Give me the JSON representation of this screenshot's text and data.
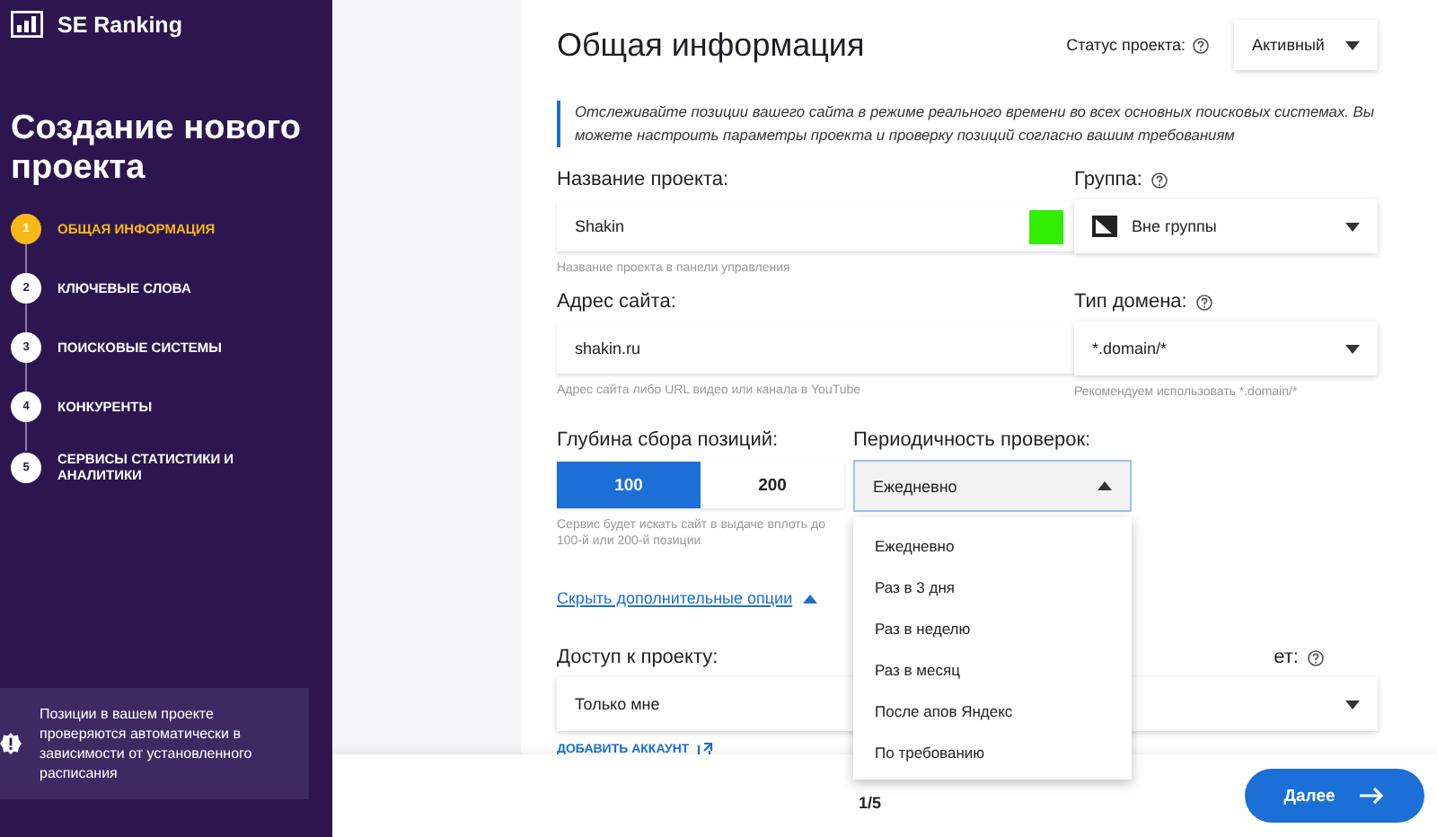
{
  "sidebar": {
    "logo": "SE Ranking",
    "title": "Создание нового проекта",
    "steps": [
      {
        "number": "1",
        "label": "ОБЩАЯ ИНФОРМАЦИЯ",
        "selected": true
      },
      {
        "number": "2",
        "label": "КЛЮЧЕВЫЕ СЛОВА",
        "selected": false
      },
      {
        "number": "3",
        "label": "ПОИСКОВЫЕ СИСТЕМЫ",
        "selected": false
      },
      {
        "number": "4",
        "label": "КОНКУРЕНТЫ",
        "selected": false
      },
      {
        "number": "5",
        "label": "СЕРВИСЫ СТАТИСТИКИ И АНАЛИТИКИ",
        "selected": false
      }
    ],
    "notice": "Позиции в вашем проекте проверяются автоматически в зависимости от установленного расписания"
  },
  "main": {
    "title": "Общая информация",
    "status": {
      "label": "Статус проекта:",
      "value": "Активный"
    },
    "description": "Отслеживайте позиции вашего сайта в режиме реального времени во всех основных поисковых системах. Вы можете настроить параметры проекта и проверку позиций согласно вашим требованиям",
    "project_name": {
      "label": "Название проекта:",
      "value": "Shakin",
      "color": "#33ee00",
      "hint": "Название проекта в панели управления"
    },
    "group": {
      "label": "Группа:",
      "value": "Вне группы"
    },
    "site_address": {
      "label": "Адрес сайта:",
      "value": "shakin.ru",
      "hint": "Адрес сайта либо URL видео или канала в YouTube"
    },
    "domain_type": {
      "label": "Тип домена:",
      "value": "*.domain/*",
      "hint": "Рекомендуем использовать *.domain/*"
    },
    "depth": {
      "label": "Глубина сбора позиций:",
      "options": [
        {
          "label": "100",
          "selected": true
        },
        {
          "label": "200",
          "selected": false
        }
      ],
      "hint": "Сервис будет искать сайт в выдаче вплоть до 100-й или 200-й позиции"
    },
    "frequency": {
      "label": "Периодичность проверок:",
      "value": "Ежедневно",
      "expanded": true,
      "options": [
        "Ежедневно",
        "Раз в 3 дня",
        "Раз в неделю",
        "Раз в месяц",
        "После апов Яндекс",
        "По требованию"
      ]
    },
    "toggle_link": "Скрыть дополнительные опции",
    "access": {
      "label": "Доступ к проекту:",
      "value": "Только мне",
      "link": "ДОБАВИТЬ АККАУНТ"
    },
    "cut_label": "ет:"
  },
  "footer": {
    "page": "1/5",
    "next": "Далее"
  }
}
